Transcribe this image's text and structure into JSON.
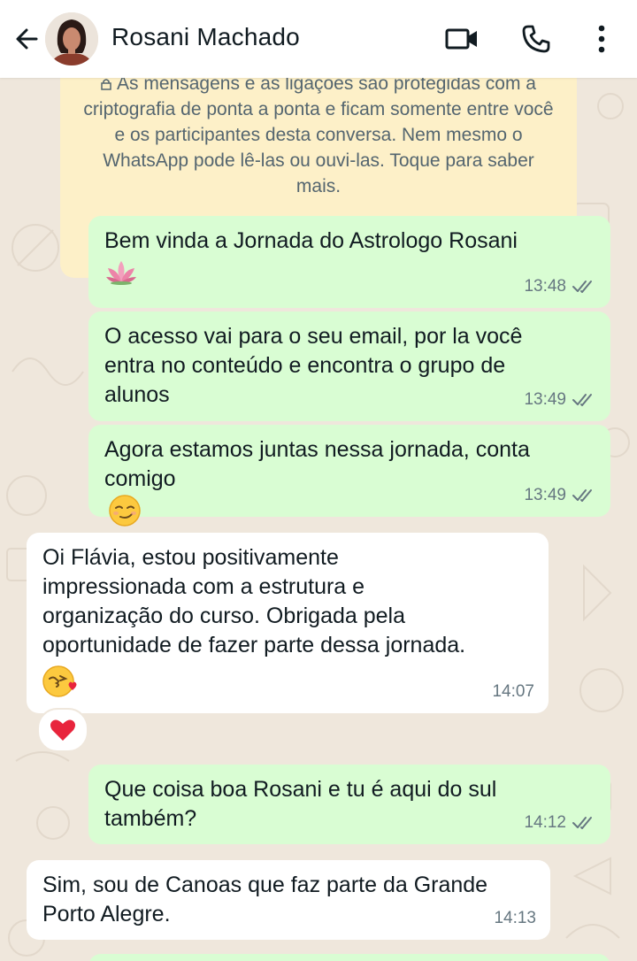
{
  "header": {
    "contact_name": "Rosani Machado"
  },
  "icons": {
    "back": "arrow-left-icon",
    "video": "video-camera-icon",
    "call": "phone-icon",
    "menu": "more-vert-icon"
  },
  "encryption_notice": {
    "text": "As mensagens e as ligações são protegidas com a criptografia de ponta a ponta e ficam somente entre você e os participantes desta conversa. Nem mesmo o WhatsApp pode lê-las ou ouvi-las. Toque para saber mais."
  },
  "messages": [
    {
      "direction": "outgoing",
      "text": "Bem vinda a Jornada do Astrologo Rosani",
      "emoji": "lotus",
      "time": "13:48",
      "status": "read"
    },
    {
      "direction": "outgoing",
      "text": "O acesso vai para o seu email, por la você\nentra no conteúdo e encontra o grupo de\nalunos",
      "time": "13:49",
      "status": "read"
    },
    {
      "direction": "outgoing",
      "text": "Agora estamos juntas nessa jornada, conta\ncomigo",
      "emoji": "smirking-face",
      "time": "13:49",
      "status": "read"
    },
    {
      "direction": "incoming",
      "text": "Oi Flávia,  estou positivamente\nimpressionada com a estrutura e\norganização do curso. Obrigada pela\noportunidade de fazer parte dessa jornada.",
      "emoji": "face-blowing-kiss",
      "time": "14:07",
      "reaction": "red-heart"
    },
    {
      "direction": "outgoing",
      "text": "Que coisa boa Rosani e tu é aqui do sul\ntambém?",
      "time": "14:12",
      "status": "read"
    },
    {
      "direction": "incoming",
      "text": "Sim, sou de Canoas que faz parte da Grande\nPorto Alegre.",
      "time": "14:13"
    }
  ],
  "colors": {
    "outgoing_bubble": "#d9fdd3",
    "incoming_bubble": "#ffffff",
    "notice_bg": "#fdf0c8",
    "wallpaper": "#efe7dc",
    "time_text": "#667781"
  }
}
